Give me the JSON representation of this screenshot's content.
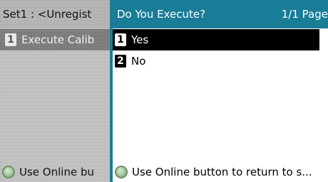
{
  "background_screen": {
    "title": "Set1 : <Unregist",
    "items": [
      {
        "number": "1",
        "label": "Execute Calib"
      }
    ],
    "footer": {
      "text": "Use Online bu",
      "icon": "online-button-icon"
    }
  },
  "dialog": {
    "title": "Do You Execute?",
    "page": "1/1 Page",
    "options": [
      {
        "number": "1",
        "label": "Yes",
        "selected": true
      },
      {
        "number": "2",
        "label": "No",
        "selected": false
      }
    ],
    "footer": {
      "text": "Use Online button to return to s...",
      "icon": "online-button-icon"
    }
  },
  "colors": {
    "title_bar": "#1a7d97",
    "selected_row": "#000000",
    "online_icon": "#9fc098"
  }
}
